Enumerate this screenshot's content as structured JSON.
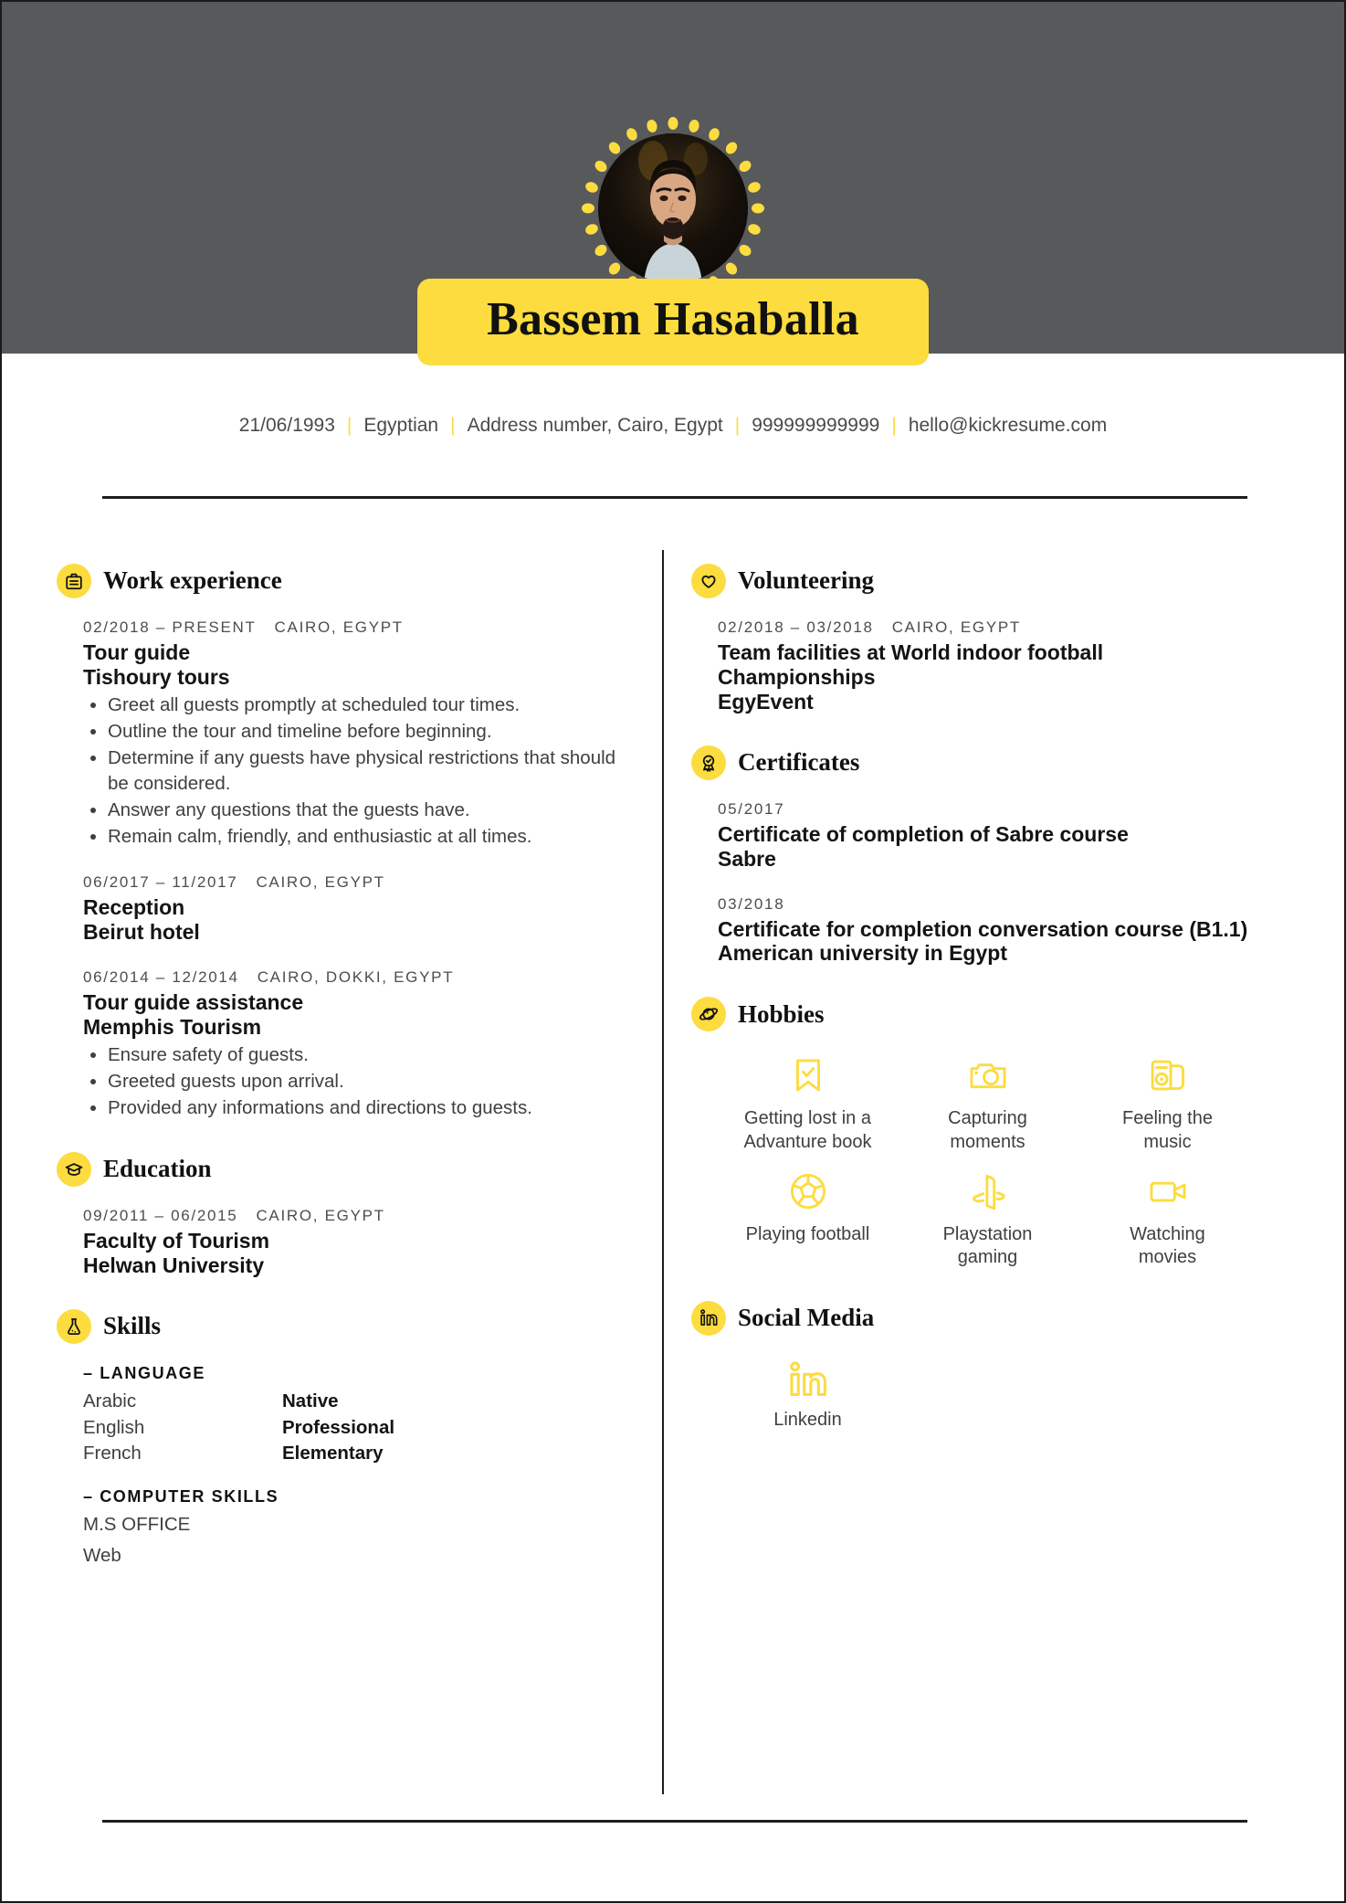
{
  "theme": {
    "accent": "#fcdc3f",
    "header_bg": "#58595b",
    "text": "#3f3f3f",
    "heading": "#111111"
  },
  "header": {
    "name": "Bassem Hasaballa",
    "avatar_alt": "profile-photo"
  },
  "contact": {
    "birthdate": "21/06/1993",
    "nationality": "Egyptian",
    "address": "Address number, Cairo, Egypt",
    "phone": "999999999999",
    "email": "hello@kickresume.com",
    "separator": "|"
  },
  "sections": {
    "work": {
      "title": "Work experience",
      "icon": "briefcase-icon",
      "entries": [
        {
          "dates": "02/2018 – PRESENT",
          "location": "CAIRO, EGYPT",
          "title": "Tour guide",
          "org": "Tishoury tours",
          "bullets": [
            "Greet all guests promptly at scheduled tour times.",
            "Outline the tour and timeline before beginning.",
            "Determine if any guests have physical restrictions that should be considered.",
            "Answer any questions that the guests have.",
            "Remain calm, friendly, and enthusiastic at all times."
          ]
        },
        {
          "dates": "06/2017 – 11/2017",
          "location": "CAIRO, EGYPT",
          "title": "Reception",
          "org": "Beirut hotel",
          "bullets": []
        },
        {
          "dates": "06/2014 – 12/2014",
          "location": "CAIRO, DOKKI, EGYPT",
          "title": "Tour guide assistance",
          "org": "Memphis Tourism",
          "bullets": [
            "Ensure safety of guests.",
            "Greeted guests upon arrival.",
            "Provided any informations and directions to guests."
          ]
        }
      ]
    },
    "education": {
      "title": "Education",
      "icon": "graduation-cap-icon",
      "entries": [
        {
          "dates": "09/2011 – 06/2015",
          "location": "CAIRO, EGYPT",
          "title": "Faculty of Tourism",
          "org": "Helwan University",
          "bullets": []
        }
      ]
    },
    "skills": {
      "title": "Skills",
      "icon": "flask-icon",
      "language_group": "– LANGUAGE",
      "languages": [
        {
          "name": "Arabic",
          "level": "Native"
        },
        {
          "name": "English",
          "level": "Professional"
        },
        {
          "name": "French",
          "level": "Elementary"
        }
      ],
      "computer_group": "– COMPUTER SKILLS",
      "computer_skills": [
        {
          "name": "M.S OFFICE",
          "percent": 100
        },
        {
          "name": "Web",
          "percent": 100
        }
      ]
    },
    "volunteering": {
      "title": "Volunteering",
      "icon": "heart-icon",
      "entries": [
        {
          "dates": "02/2018 – 03/2018",
          "location": "CAIRO, EGYPT",
          "title": "Team facilities at World indoor football Championships",
          "org": "EgyEvent",
          "bullets": []
        }
      ]
    },
    "certificates": {
      "title": "Certificates",
      "icon": "award-check-icon",
      "entries": [
        {
          "dates": "05/2017",
          "location": "",
          "title": "Certificate of completion of Sabre course",
          "org": "Sabre",
          "bullets": []
        },
        {
          "dates": "03/2018",
          "location": "",
          "title": "Certificate for completion conversation course (B1.1)",
          "org": "American university in Egypt",
          "bullets": []
        }
      ]
    },
    "hobbies": {
      "title": "Hobbies",
      "icon": "planet-icon",
      "items": [
        {
          "label": "Getting lost in a Advanture book",
          "icon": "bookmark-check-icon"
        },
        {
          "label": "Capturing moments",
          "icon": "camera-icon"
        },
        {
          "label": "Feeling the music",
          "icon": "music-player-icon"
        },
        {
          "label": "Playing football",
          "icon": "football-icon"
        },
        {
          "label": "Playstation gaming",
          "icon": "playstation-icon"
        },
        {
          "label": "Watching movies",
          "icon": "movie-icon"
        }
      ]
    },
    "social": {
      "title": "Social Media",
      "icon": "linkedin-badge-icon",
      "items": [
        {
          "label": "Linkedin",
          "icon": "linkedin-icon"
        }
      ]
    }
  }
}
